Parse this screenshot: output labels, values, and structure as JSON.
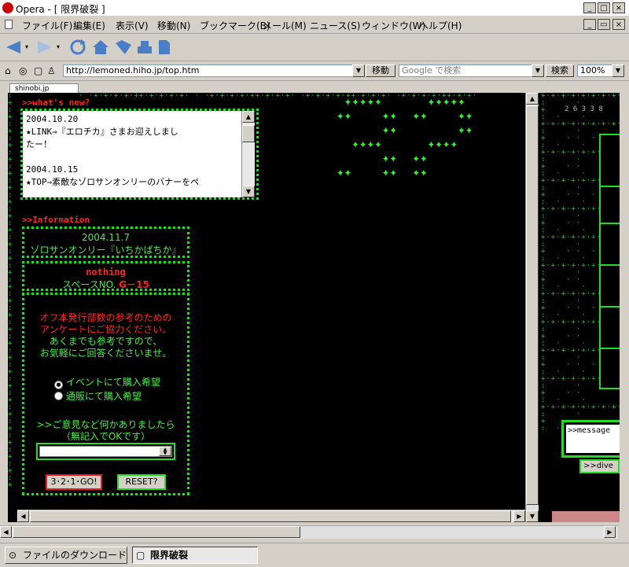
{
  "window": {
    "title": "Opera - [ 限界破裂 ]"
  },
  "menu": [
    "ファイル(F)",
    "編集(E)",
    "表示(V)",
    "移動(N)",
    "ブックマーク(B)",
    "メール(M)",
    "ニュース(S)",
    "ウィンドウ(W)",
    "ヘルプ(H)"
  ],
  "address": {
    "url": "http://lemoned.hiho.jp/top.htm",
    "go_label": "移動",
    "search_placeholder": "Google で検索",
    "search_label": "検索",
    "zoom": "100%"
  },
  "page_tab": {
    "label": "shinobi.jp"
  },
  "whats_new": {
    "heading": ">>what's new?",
    "entries": [
      {
        "date": "2004.10.20",
        "text_1": "★LINK⇒『エロチカ』さまお迎えしまし",
        "text_2": "たー！"
      },
      {
        "date": "2004.10.15",
        "text_1": "★TOP⇒素敵なゾロサンオンリーのバナーをペ"
      }
    ]
  },
  "information": {
    "heading": ">>Information",
    "event_date": "2004.11.7",
    "event_name": "ゾロサンオンリー『いちかばちか』",
    "status": "nothing",
    "space_label": "スペースNO.",
    "space_number": "G－15"
  },
  "survey": {
    "line1": "オフ本発行部数の参考のための",
    "line2": "アンケートにご協力ください。",
    "line3": "あくまでも参考ですので、",
    "line4": "お気軽にご回答くださいませ。",
    "option1": "イベントにて購入希望",
    "option2": "通販にて購入希望",
    "selected": 1,
    "comment_line1": ">>ご意見など何かありましたら",
    "comment_line2": "（無記入でOKです）",
    "submit_label": "3･2･1･GO!",
    "reset_label": "RESET?"
  },
  "right_panel": {
    "counter": "2 6 3 3 8",
    "message_label": ">>message",
    "dive_label": ">>dive"
  },
  "status_tabs": {
    "downloads": "ファイルのダウンロード",
    "active_page": "限界破裂"
  },
  "colors": {
    "accent_green": "#22dd22",
    "accent_red": "#ff2222",
    "page_bg": "#000000"
  }
}
